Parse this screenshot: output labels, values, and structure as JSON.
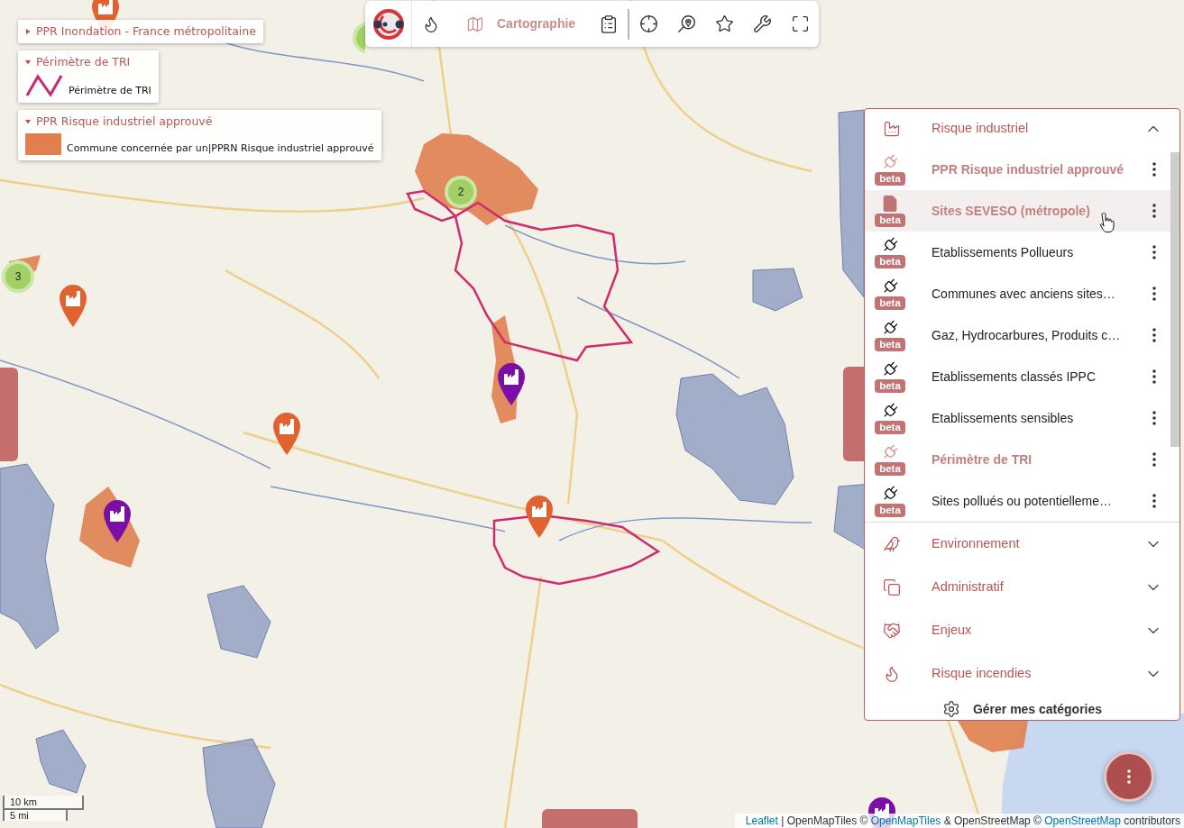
{
  "toolbar": {
    "mode_tab": {
      "label": "Cartographie",
      "selected": true
    }
  },
  "legends": [
    {
      "title": "PPR Inondation - France métropolitaine",
      "expanded": false
    },
    {
      "title": "Périmètre de TRI",
      "expanded": true,
      "entries": [
        {
          "kind": "line",
          "color": "#c8286e",
          "label": "Périmètre de TRI"
        }
      ]
    },
    {
      "title": "PPR Risque industriel approuvé",
      "expanded": true,
      "entries": [
        {
          "kind": "fill",
          "color": "#e0804f",
          "label": "Commune concernée par un|PPRN Risque industriel approuvé"
        }
      ]
    }
  ],
  "map": {
    "markers": [
      {
        "kind": "pin",
        "color": "#e0622f"
      },
      {
        "kind": "pin",
        "color": "#e0622f"
      },
      {
        "kind": "pin",
        "color": "#e0622f"
      },
      {
        "kind": "pin",
        "color": "#7a0ea6"
      },
      {
        "kind": "pin",
        "color": "#7a0ea6"
      },
      {
        "kind": "pin",
        "color": "#e0622f"
      },
      {
        "kind": "pin",
        "color": "#7a0ea6"
      },
      {
        "kind": "cluster",
        "label": "2"
      },
      {
        "kind": "cluster",
        "label": "3"
      },
      {
        "kind": "cluster"
      }
    ]
  },
  "layers_panel": {
    "categories": [
      {
        "title": "Risque industriel",
        "expanded": true,
        "layers": [
          {
            "name": "PPR Risque industriel approuvé",
            "kind": "plug",
            "active": true,
            "hovered": false,
            "badge": "beta"
          },
          {
            "name": "Sites SEVESO (métropole)",
            "kind": "document",
            "active": true,
            "hovered": true,
            "badge": "beta"
          },
          {
            "name": "Etablissements Pollueurs",
            "kind": "plug",
            "active": false,
            "hovered": false,
            "badge": "beta"
          },
          {
            "name": "Communes avec anciens sites…",
            "kind": "plug",
            "active": false,
            "hovered": false,
            "badge": "beta"
          },
          {
            "name": "Gaz, Hydrocarbures, Produits c…",
            "kind": "plug",
            "active": false,
            "hovered": false,
            "badge": "beta"
          },
          {
            "name": "Etablissements classés IPPC",
            "kind": "plug",
            "active": false,
            "hovered": false,
            "badge": "beta"
          },
          {
            "name": "Etablissements sensibles",
            "kind": "plug",
            "active": false,
            "hovered": false,
            "badge": "beta"
          },
          {
            "name": "Périmètre de TRI",
            "kind": "plug",
            "active": true,
            "hovered": false,
            "badge": "beta"
          },
          {
            "name": "Sites pollués ou potentielleme…",
            "kind": "plug",
            "active": false,
            "hovered": false,
            "badge": "beta"
          }
        ]
      },
      {
        "title": "Environnement",
        "expanded": false
      },
      {
        "title": "Administratif",
        "expanded": false
      },
      {
        "title": "Enjeux",
        "expanded": false
      },
      {
        "title": "Risque incendies",
        "expanded": false
      }
    ],
    "manage_label": "Gérer mes catégories"
  },
  "scale": {
    "metric": "10 km",
    "imperial": "5 mi"
  },
  "attribution": [
    {
      "kind": "link",
      "text": "Leaflet"
    },
    {
      "kind": "text",
      "text": " | OpenMapTiles © "
    },
    {
      "kind": "link",
      "text": "OpenMapTiles"
    },
    {
      "kind": "text",
      "text": " & OpenStreetMap © "
    },
    {
      "kind": "link",
      "text": "OpenStreetMap"
    },
    {
      "kind": "text",
      "text": " contributors"
    }
  ]
}
